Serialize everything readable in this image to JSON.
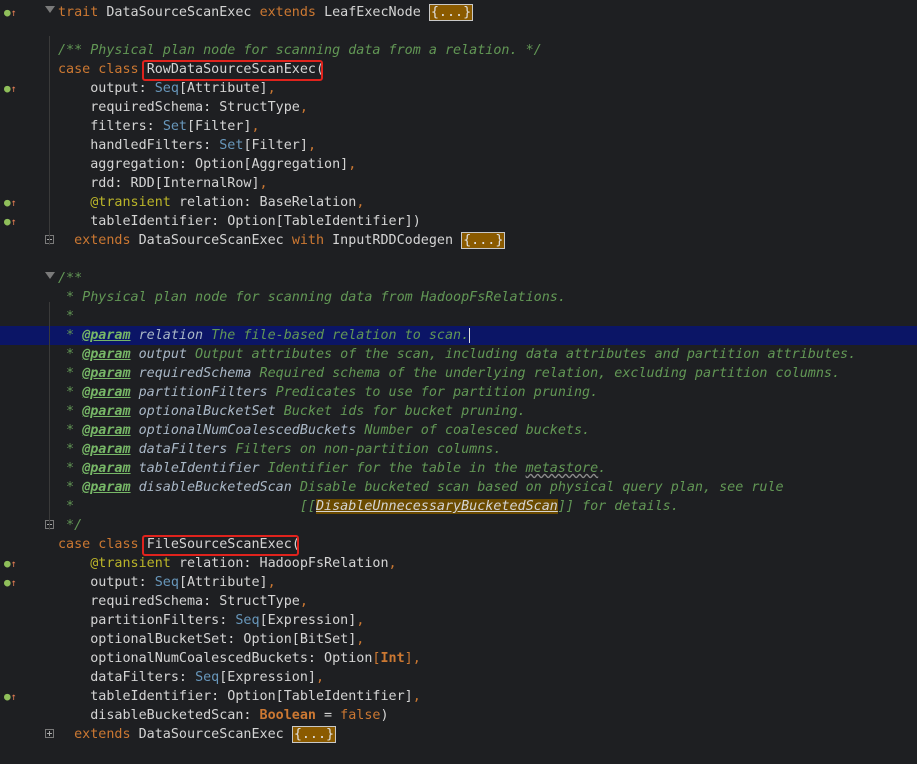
{
  "editor": {
    "lines": [
      {
        "id": 1,
        "segments": [
          [
            "kw",
            "trait "
          ],
          [
            "",
            "DataSourceScanExec "
          ],
          [
            "kw",
            "extends "
          ],
          [
            "",
            "LeafExecNode "
          ],
          [
            "ph",
            "{...}"
          ]
        ]
      },
      {
        "id": 2,
        "segments": []
      },
      {
        "id": 3,
        "segments": [
          [
            "doc",
            "/** Physical plan node for scanning data from a relation. */"
          ]
        ]
      },
      {
        "id": 4,
        "segments": [
          [
            "kw",
            "case class "
          ],
          [
            "",
            "RowDataSourceScanExec"
          ],
          [
            "",
            "("
          ]
        ]
      },
      {
        "id": 5,
        "segments": [
          [
            "",
            "    output: "
          ],
          [
            "ty",
            "Seq"
          ],
          [
            "",
            "[Attribute]"
          ],
          [
            "kw",
            ","
          ]
        ]
      },
      {
        "id": 6,
        "segments": [
          [
            "",
            "    requiredSchema: StructType"
          ],
          [
            "kw",
            ","
          ]
        ]
      },
      {
        "id": 7,
        "segments": [
          [
            "",
            "    filters: "
          ],
          [
            "ty",
            "Set"
          ],
          [
            "",
            "[Filter]"
          ],
          [
            "kw",
            ","
          ]
        ]
      },
      {
        "id": 8,
        "segments": [
          [
            "",
            "    handledFilters: "
          ],
          [
            "ty",
            "Set"
          ],
          [
            "",
            "[Filter]"
          ],
          [
            "kw",
            ","
          ]
        ]
      },
      {
        "id": 9,
        "segments": [
          [
            "",
            "    aggregation: Option[Aggregation]"
          ],
          [
            "kw",
            ","
          ]
        ]
      },
      {
        "id": 10,
        "segments": [
          [
            "",
            "    rdd: RDD[InternalRow]"
          ],
          [
            "kw",
            ","
          ]
        ]
      },
      {
        "id": 11,
        "segments": [
          [
            "ann",
            "    @transient "
          ],
          [
            "",
            "relation: BaseRelation"
          ],
          [
            "kw",
            ","
          ]
        ]
      },
      {
        "id": 12,
        "segments": [
          [
            "",
            "    tableIdentifier: Option[TableIdentifier])"
          ]
        ]
      },
      {
        "id": 13,
        "segments": [
          [
            "kw",
            "  extends "
          ],
          [
            "",
            "DataSourceScanExec "
          ],
          [
            "kw",
            "with "
          ],
          [
            "",
            "InputRDDCodegen "
          ],
          [
            "ph",
            "{...}"
          ]
        ]
      },
      {
        "id": 14,
        "segments": []
      },
      {
        "id": 15,
        "segments": [
          [
            "doc",
            "/**"
          ]
        ]
      },
      {
        "id": 16,
        "segments": [
          [
            "doc",
            " * Physical plan node for scanning data from HadoopFsRelations."
          ]
        ]
      },
      {
        "id": 17,
        "segments": [
          [
            "doc",
            " *"
          ]
        ]
      },
      {
        "id": 18,
        "segments": [
          [
            "doc",
            " * "
          ],
          [
            "tag",
            "@param"
          ],
          [
            "param",
            " relation"
          ],
          [
            "doc",
            " The file-based relation to scan."
          ]
        ]
      },
      {
        "id": 19,
        "segments": [
          [
            "doc",
            " * "
          ],
          [
            "tag",
            "@param"
          ],
          [
            "param",
            " output"
          ],
          [
            "doc",
            " Output attributes of the scan, including data attributes and partition attributes."
          ]
        ]
      },
      {
        "id": 20,
        "segments": [
          [
            "doc",
            " * "
          ],
          [
            "tag",
            "@param"
          ],
          [
            "param",
            " requiredSchema"
          ],
          [
            "doc",
            " Required schema of the underlying relation, excluding partition columns."
          ]
        ]
      },
      {
        "id": 21,
        "segments": [
          [
            "doc",
            " * "
          ],
          [
            "tag",
            "@param"
          ],
          [
            "param",
            " partitionFilters"
          ],
          [
            "doc",
            " Predicates to use for partition pruning."
          ]
        ]
      },
      {
        "id": 22,
        "segments": [
          [
            "doc",
            " * "
          ],
          [
            "tag",
            "@param"
          ],
          [
            "param",
            " optionalBucketSet"
          ],
          [
            "doc",
            " Bucket ids for bucket pruning."
          ]
        ]
      },
      {
        "id": 23,
        "segments": [
          [
            "doc",
            " * "
          ],
          [
            "tag",
            "@param"
          ],
          [
            "param",
            " optionalNumCoalescedBuckets"
          ],
          [
            "doc",
            " Number of coalesced buckets."
          ]
        ]
      },
      {
        "id": 24,
        "segments": [
          [
            "doc",
            " * "
          ],
          [
            "tag",
            "@param"
          ],
          [
            "param",
            " dataFilters"
          ],
          [
            "doc",
            " Filters on non-partition columns."
          ]
        ]
      },
      {
        "id": 25,
        "segments": [
          [
            "doc",
            " * "
          ],
          [
            "tag",
            "@param"
          ],
          [
            "param",
            " tableIdentifier"
          ],
          [
            "doc",
            " Identifier for the table in the "
          ],
          [
            "squigdoc",
            "metastore"
          ],
          [
            "doc",
            "."
          ]
        ]
      },
      {
        "id": 26,
        "segments": [
          [
            "doc",
            " * "
          ],
          [
            "tag",
            "@param"
          ],
          [
            "param",
            " disableBucketedScan"
          ],
          [
            "doc",
            " Disable bucketed scan based on physical query plan, see rule"
          ]
        ]
      },
      {
        "id": 27,
        "segments": [
          [
            "doc",
            " *                            [["
          ],
          [
            "phlink",
            "DisableUnnecessaryBucketedScan"
          ],
          [
            "doc",
            "]] for details."
          ]
        ]
      },
      {
        "id": 28,
        "segments": [
          [
            "doc",
            " */"
          ]
        ]
      },
      {
        "id": 29,
        "segments": [
          [
            "kw",
            "case class "
          ],
          [
            "",
            "FileSourceScanExec"
          ],
          [
            "",
            "("
          ]
        ]
      },
      {
        "id": 30,
        "segments": [
          [
            "ann",
            "    @transient "
          ],
          [
            "",
            "relation: HadoopFsRelation"
          ],
          [
            "kw",
            ","
          ]
        ]
      },
      {
        "id": 31,
        "segments": [
          [
            "",
            "    output: "
          ],
          [
            "ty",
            "Seq"
          ],
          [
            "",
            "[Attribute]"
          ],
          [
            "kw",
            ","
          ]
        ]
      },
      {
        "id": 32,
        "segments": [
          [
            "",
            "    requiredSchema: StructType"
          ],
          [
            "kw",
            ","
          ]
        ]
      },
      {
        "id": 33,
        "segments": [
          [
            "",
            "    partitionFilters: "
          ],
          [
            "ty",
            "Seq"
          ],
          [
            "",
            "[Expression]"
          ],
          [
            "kw",
            ","
          ]
        ]
      },
      {
        "id": 34,
        "segments": [
          [
            "",
            "    optionalBucketSet: Option[BitSet]"
          ],
          [
            "kw",
            ","
          ]
        ]
      },
      {
        "id": 35,
        "segments": [
          [
            "",
            "    optionalNumCoalescedBuckets: Option"
          ],
          [
            "kw",
            "["
          ],
          [
            "boolkw",
            "Int"
          ],
          [
            "kw",
            "]"
          ],
          [
            "kw",
            ","
          ]
        ]
      },
      {
        "id": 36,
        "segments": [
          [
            "",
            "    dataFilters: "
          ],
          [
            "ty",
            "Seq"
          ],
          [
            "",
            "[Expression]"
          ],
          [
            "kw",
            ","
          ]
        ]
      },
      {
        "id": 37,
        "segments": [
          [
            "",
            "    tableIdentifier: Option[TableIdentifier]"
          ],
          [
            "kw",
            ","
          ]
        ]
      },
      {
        "id": 38,
        "segments": [
          [
            "",
            "    disableBucketedScan: "
          ],
          [
            "boolkw",
            "Boolean"
          ],
          [
            "",
            " = "
          ],
          [
            "kw",
            "false"
          ],
          [
            "",
            ")"
          ]
        ]
      },
      {
        "id": 39,
        "segments": [
          [
            "kw",
            "  extends "
          ],
          [
            "",
            "DataSourceScanExec "
          ],
          [
            "ph",
            "{...}"
          ]
        ]
      }
    ]
  },
  "gutter": {
    "override_icon_lines": [
      1,
      5,
      11,
      12,
      30,
      31,
      37
    ],
    "highlighted_line": 18
  },
  "colors": {
    "background": "#1e1f22",
    "keyword": "#cc7832",
    "doc_comment": "#629755",
    "highlight_line": "#0b1566",
    "annotation_box": "#e0231d"
  }
}
